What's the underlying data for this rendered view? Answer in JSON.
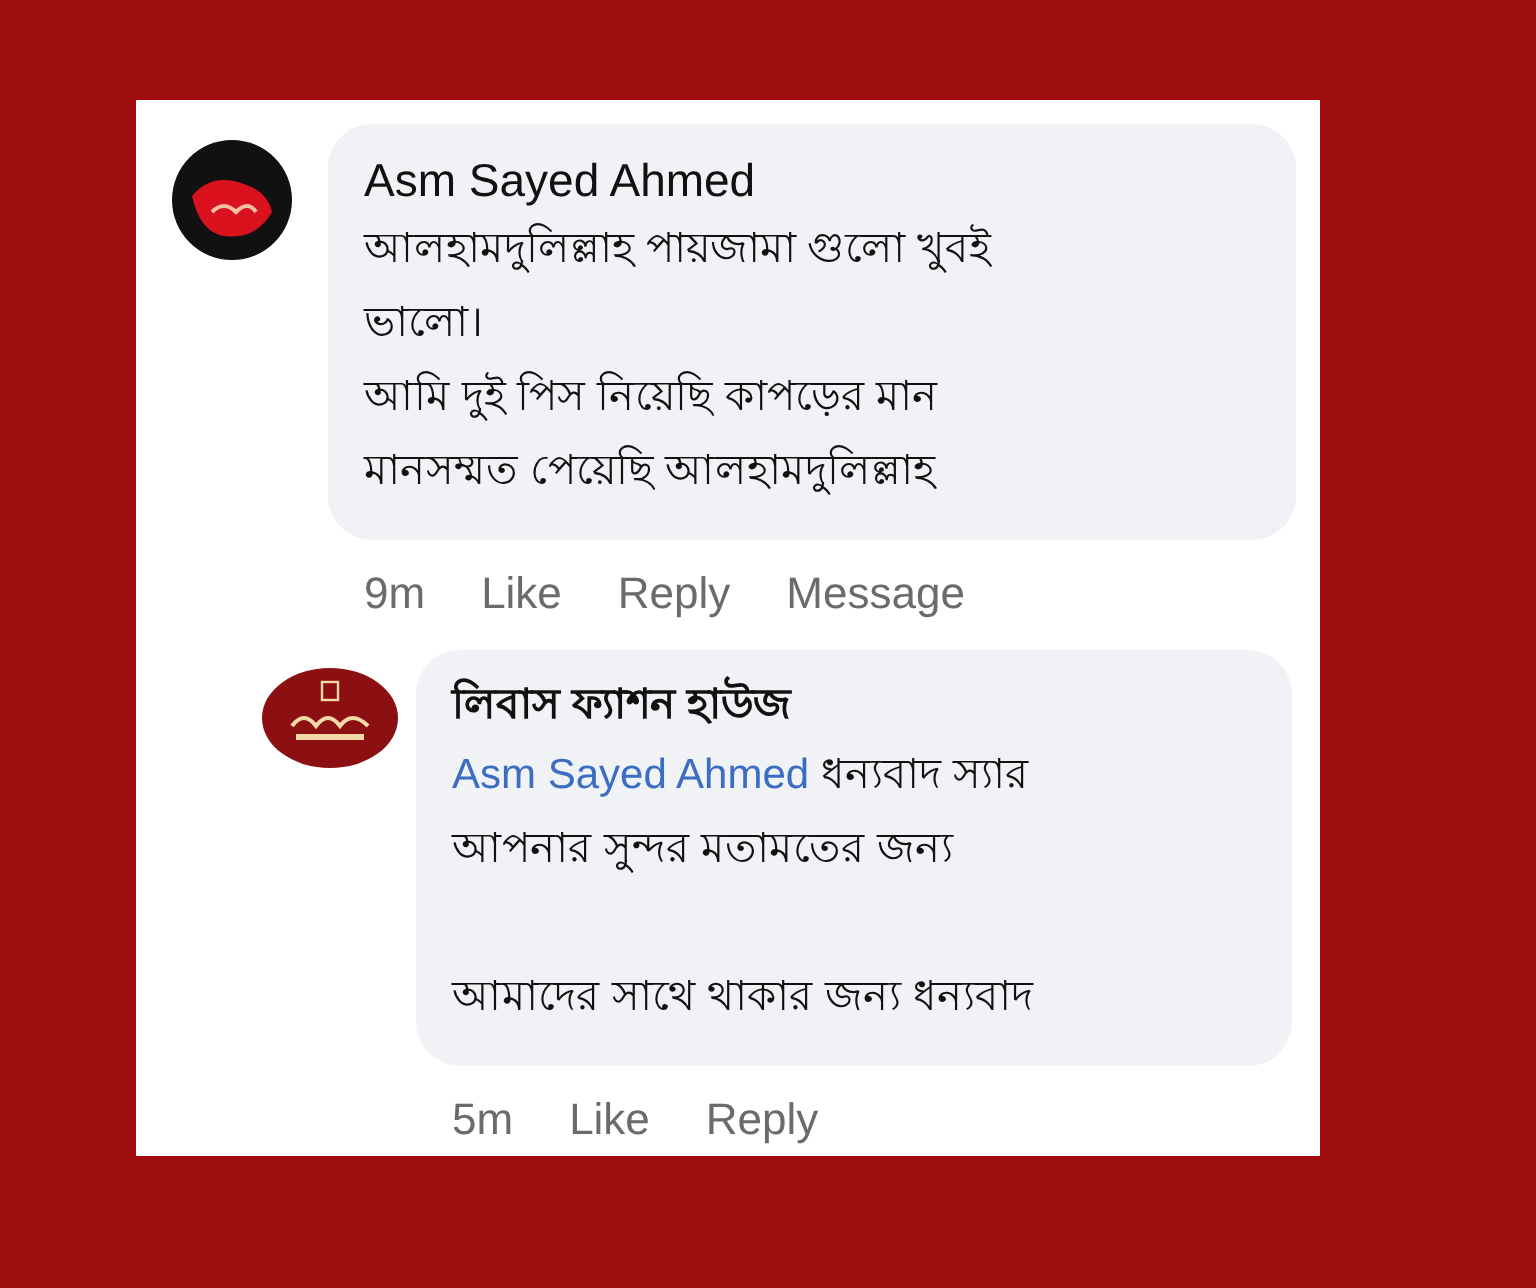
{
  "comments": [
    {
      "kind": "comment",
      "author": "Asm Sayed Ahmed",
      "paragraphs": [
        {
          "text": "আলহামদুলিল্লাহ পায়জামা গুলো খুবই ভালো।"
        },
        {
          "text": "আমি দুই পিস নিয়েছি কাপড়ের মান মানসম্মত পেয়েছি আলহামদুলিল্লাহ"
        }
      ],
      "time": "9m",
      "actions": [
        "Like",
        "Reply",
        "Message"
      ]
    },
    {
      "kind": "reply",
      "author": "লিবাস ফ্যাশন হাউজ",
      "paragraphs": [
        {
          "mention": "Asm Sayed Ahmed",
          "text": "ধন্যবাদ স্যার আপনার সুন্দর মতামতের জন্য"
        },
        {
          "text": "আমাদের সাথে থাকার জন্য ধন্যবাদ"
        }
      ],
      "time": "5m",
      "actions": [
        "Like",
        "Reply"
      ]
    }
  ]
}
